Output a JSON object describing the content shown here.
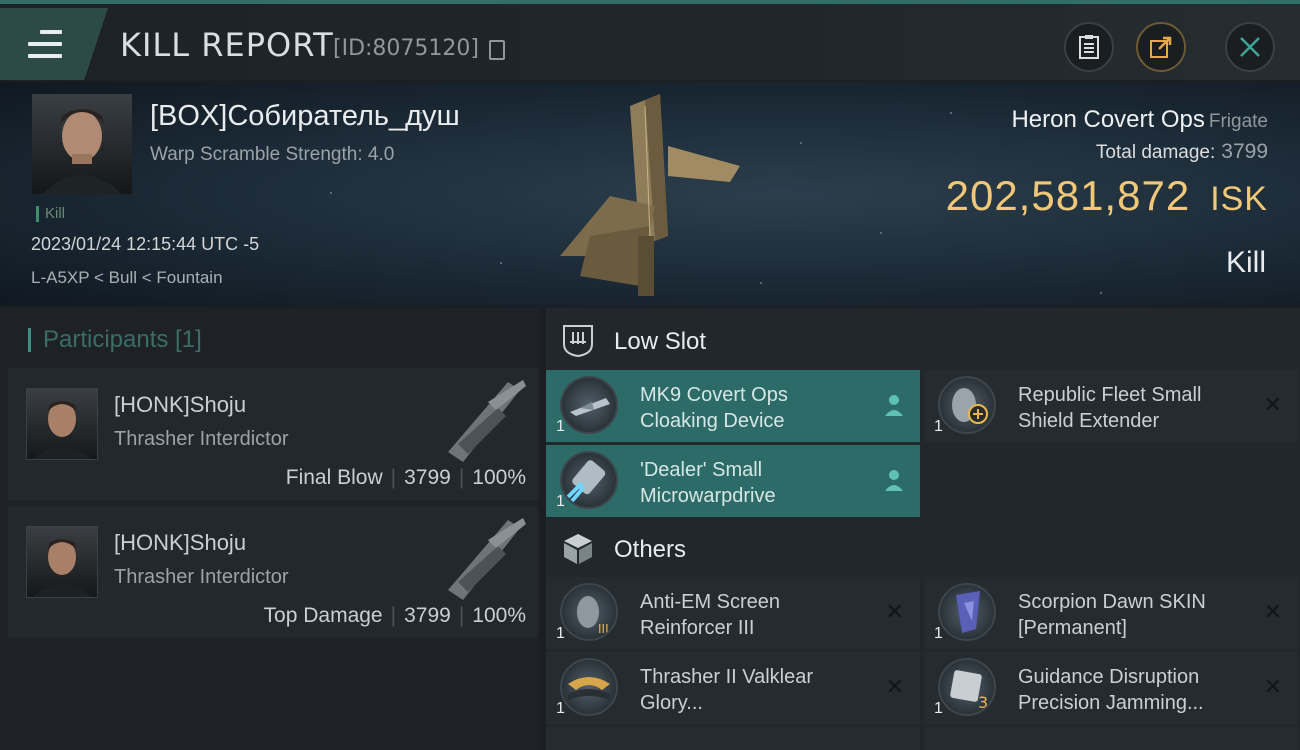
{
  "header": {
    "title": "KILL REPORT",
    "report_id": "[ID:8075120]",
    "icons": [
      "menu-icon",
      "copy-icon",
      "clipboard-icon",
      "share-icon",
      "close-icon"
    ]
  },
  "victim": {
    "name": "[BOX]Собиратель_душ",
    "warp_scramble": "Warp Scramble Strength: 4.0",
    "tag": "Kill",
    "datetime": "2023/01/24 12:15:44 UTC -5",
    "location": "L-A5XP < Bull < Fountain",
    "ship_name": "Heron Covert Ops",
    "ship_class": "Frigate",
    "total_damage_label": "Total damage:",
    "total_damage_value": "3799",
    "isk_value": "202,581,872",
    "isk_unit": "ISK",
    "result": "Kill"
  },
  "participants": {
    "title": "Participants [1]",
    "list": [
      {
        "name": "[HONK]Shoju",
        "ship": "Thrasher Interdictor",
        "role": "Final Blow",
        "damage": "3799",
        "percent": "100%"
      },
      {
        "name": "[HONK]Shoju",
        "ship": "Thrasher Interdictor",
        "role": "Top Damage",
        "damage": "3799",
        "percent": "100%"
      }
    ]
  },
  "sections": {
    "low_slot": {
      "label": "Low Slot",
      "items": [
        {
          "name_line1": "MK9 Covert Ops",
          "name_line2": "Cloaking Device",
          "qty": "1",
          "status": "active"
        },
        {
          "name_line1": "Republic Fleet Small",
          "name_line2": "Shield Extender",
          "qty": "1",
          "status": "destroyed"
        },
        {
          "name_line1": "'Dealer' Small",
          "name_line2": "Microwarpdrive",
          "qty": "1",
          "status": "active"
        }
      ]
    },
    "others": {
      "label": "Others",
      "items": [
        {
          "name_line1": "Anti-EM Screen",
          "name_line2": "Reinforcer III",
          "qty": "1",
          "badge": "III",
          "status": "destroyed"
        },
        {
          "name_line1": "Scorpion Dawn SKIN",
          "name_line2": "[Permanent]",
          "qty": "1",
          "status": "destroyed"
        },
        {
          "name_line1": "Thrasher II Valklear",
          "name_line2": "Glory...",
          "qty": "1",
          "status": "destroyed"
        },
        {
          "name_line1": "Guidance Disruption",
          "name_line2": "Precision Jamming...",
          "qty": "1",
          "badge": "3",
          "status": "destroyed"
        }
      ]
    }
  },
  "colors": {
    "accent_teal": "#2c6b68",
    "isk_gold": "#f0c878",
    "background": "#1b1f23"
  }
}
